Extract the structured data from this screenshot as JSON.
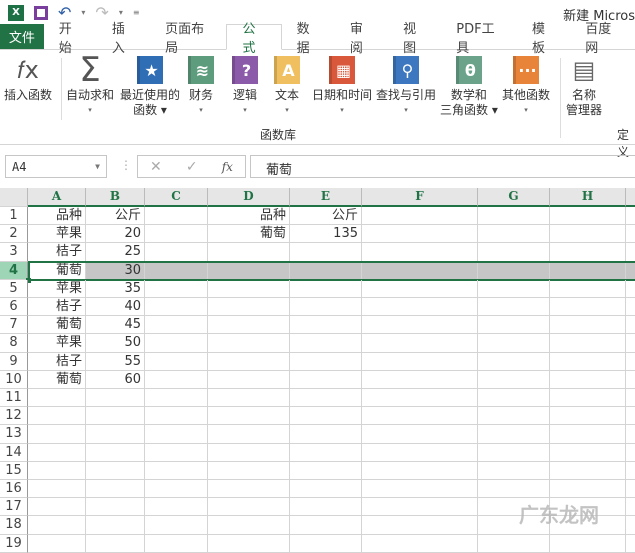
{
  "window": {
    "title": "新建 Micros"
  },
  "tabs": [
    {
      "label": "文件"
    },
    {
      "label": "开始"
    },
    {
      "label": "插入"
    },
    {
      "label": "页面布局"
    },
    {
      "label": "公式",
      "active": true
    },
    {
      "label": "数据"
    },
    {
      "label": "审阅"
    },
    {
      "label": "视图"
    },
    {
      "label": "PDF工具"
    },
    {
      "label": "模板"
    },
    {
      "label": "百度网"
    }
  ],
  "ribbon": {
    "group_label": "函数库",
    "group2_label": "定义",
    "buttons": [
      {
        "l1": "插入函数",
        "l2": "",
        "icon": "fx-icon",
        "color": "#555555"
      },
      {
        "l1": "自动求和",
        "l2": "▾",
        "icon": "sigma-icon",
        "color": "#555555"
      },
      {
        "l1": "最近使用的",
        "l2": "函数 ▾",
        "icon": "star-book-icon",
        "color": "#2f6db5"
      },
      {
        "l1": "财务",
        "l2": "▾",
        "icon": "coins-book-icon",
        "color": "#5e9c7e"
      },
      {
        "l1": "逻辑",
        "l2": "▾",
        "icon": "question-book-icon",
        "color": "#8b5aa8"
      },
      {
        "l1": "文本",
        "l2": "▾",
        "icon": "text-book-icon",
        "color": "#f0c060"
      },
      {
        "l1": "日期和时间",
        "l2": "▾",
        "icon": "calendar-book-icon",
        "color": "#d9573a"
      },
      {
        "l1": "查找与引用",
        "l2": "▾",
        "icon": "search-book-icon",
        "color": "#3d77bf"
      },
      {
        "l1": "数学和",
        "l2": "三角函数 ▾",
        "icon": "theta-book-icon",
        "color": "#6aa38a"
      },
      {
        "l1": "其他函数",
        "l2": "▾",
        "icon": "more-book-icon",
        "color": "#e8833a"
      },
      {
        "l1": "名称",
        "l2": "管理器",
        "icon": "name-manager-icon",
        "color": "#666666"
      }
    ]
  },
  "formula_bar": {
    "name_box": "A4",
    "value": "葡萄"
  },
  "sheet": {
    "columns": [
      "A",
      "B",
      "C",
      "D",
      "E",
      "F",
      "G",
      "H"
    ],
    "selected_row": 4,
    "rows": [
      {
        "A": "品种",
        "B": "公斤",
        "D": "品种",
        "E": "公斤"
      },
      {
        "A": "苹果",
        "B": "20",
        "D": "葡萄",
        "E": "135"
      },
      {
        "A": "桔子",
        "B": "25"
      },
      {
        "A": "葡萄",
        "B": "30"
      },
      {
        "A": "苹果",
        "B": "35"
      },
      {
        "A": "桔子",
        "B": "40"
      },
      {
        "A": "葡萄",
        "B": "45"
      },
      {
        "A": "苹果",
        "B": "50"
      },
      {
        "A": "桔子",
        "B": "55"
      },
      {
        "A": "葡萄",
        "B": "60"
      },
      {},
      {},
      {},
      {},
      {},
      {},
      {},
      {},
      {}
    ]
  },
  "watermark": "广东龙网"
}
